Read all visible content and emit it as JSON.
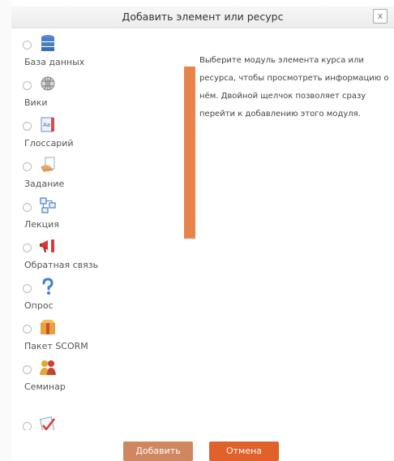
{
  "dialog": {
    "title": "Добавить элемент или ресурс",
    "close_label": "x"
  },
  "modules": [
    {
      "label": "База данных",
      "icon": "database-icon"
    },
    {
      "label": "Вики",
      "icon": "wiki-icon"
    },
    {
      "label": "Глоссарий",
      "icon": "glossary-icon"
    },
    {
      "label": "Задание",
      "icon": "assignment-icon"
    },
    {
      "label": "Лекция",
      "icon": "lesson-icon"
    },
    {
      "label": "Обратная связь",
      "icon": "feedback-icon"
    },
    {
      "label": "Опрос",
      "icon": "survey-icon"
    },
    {
      "label": "Пакет SCORM",
      "icon": "scorm-package-icon"
    },
    {
      "label": "Семинар",
      "icon": "workshop-icon"
    },
    {
      "label": "",
      "icon": "quiz-icon"
    }
  ],
  "description": "Выберите модуль элемента курса или ресурса, чтобы просмотреть информацию о нём. Двойной щелчок позволяет сразу перейти к добавлению этого модуля.",
  "buttons": {
    "add_label": "Добавить",
    "cancel_label": "Отмена"
  },
  "colors": {
    "accent": "#e8844a",
    "cancel": "#e0612a",
    "add": "#d08760"
  }
}
